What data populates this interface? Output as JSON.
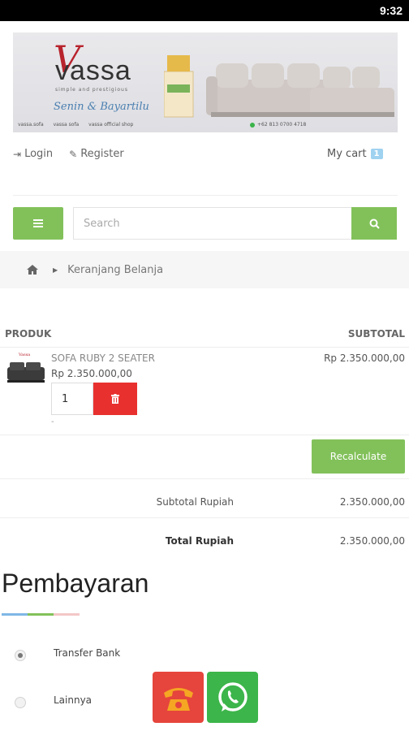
{
  "status_bar": {
    "time": "9:32"
  },
  "banner": {
    "brand_initial": "V",
    "brand": "vassa",
    "tagline": "simple and prestigious",
    "script_text": "Senin & Bayartilu",
    "socials": [
      "vassa.sofa",
      "vassa sofa",
      "vassa official shop"
    ],
    "phone": "+62 813 0700 4718"
  },
  "nav": {
    "login": "Login",
    "register": "Register",
    "my_cart": "My cart",
    "cart_count": "1"
  },
  "search": {
    "placeholder": "Search"
  },
  "breadcrumb": {
    "current": "Keranjang Belanja"
  },
  "cart": {
    "col_product": "PRODUK",
    "col_subtotal": "SUBTOTAL",
    "items": [
      {
        "name": "SOFA RUBY 2 SEATER",
        "price": "Rp 2.350.000,00",
        "subtotal": "Rp 2.350.000,00",
        "quantity": "1",
        "note": "-"
      }
    ],
    "recalculate": "Recalculate",
    "subtotal_label": "Subtotal Rupiah",
    "subtotal_value": "2.350.000,00",
    "total_label": "Total Rupiah",
    "total_value": "2.350.000,00"
  },
  "payment": {
    "title": "Pembayaran",
    "options": [
      {
        "label": "Transfer Bank",
        "selected": true
      },
      {
        "label": "Lainnya",
        "selected": false
      }
    ]
  },
  "colors": {
    "accent_green": "#82c15a",
    "delete_red": "#e8312f",
    "phone_button": "#e5453c",
    "whatsapp_button": "#3cb54a",
    "badge_blue": "#9fd2f0",
    "underline": [
      "#7fb7e6",
      "#82c15a",
      "#f4c7c7"
    ]
  },
  "icons": {
    "login": "sign-in-icon",
    "register": "edit-icon",
    "menu": "bars-icon",
    "search": "search-icon",
    "home": "home-icon",
    "delete": "trash-icon",
    "call": "phone-icon",
    "whatsapp": "whatsapp-icon"
  }
}
